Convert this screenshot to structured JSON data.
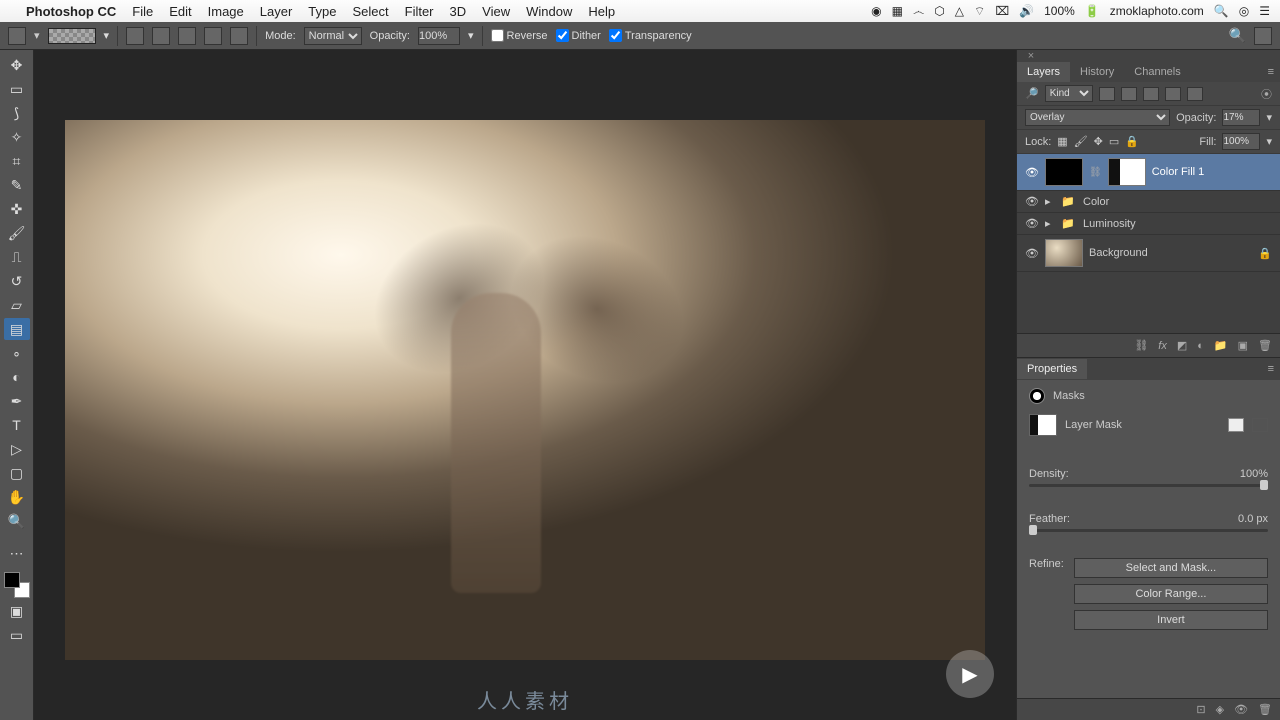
{
  "menubar": {
    "app": "Photoshop CC",
    "items": [
      "File",
      "Edit",
      "Image",
      "Layer",
      "Type",
      "Select",
      "Filter",
      "3D",
      "View",
      "Window",
      "Help"
    ],
    "battery": "100%",
    "site": "zmoklaphoto.com"
  },
  "options": {
    "mode_label": "Mode:",
    "mode_value": "Normal",
    "opacity_label": "Opacity:",
    "opacity_value": "100%",
    "reverse": "Reverse",
    "dither": "Dither",
    "transparency": "Transparency"
  },
  "tools": [
    "move",
    "marquee",
    "lasso",
    "wand",
    "crop",
    "eyedropper",
    "brush-heal",
    "brush",
    "stamp",
    "history-brush",
    "eraser",
    "gradient",
    "blur",
    "dodge",
    "pen",
    "type",
    "path-select",
    "rectangle",
    "hand",
    "zoom"
  ],
  "layers_panel": {
    "tabs": [
      "Layers",
      "History",
      "Channels"
    ],
    "active_tab": 0,
    "kind_label": "Kind",
    "blend_mode": "Overlay",
    "opacity_label": "Opacity:",
    "opacity_value": "17%",
    "lock_label": "Lock:",
    "fill_label": "Fill:",
    "fill_value": "100%",
    "layers": [
      {
        "name": "Color Fill 1",
        "type": "fill",
        "selected": true
      },
      {
        "name": "Color",
        "type": "group"
      },
      {
        "name": "Luminosity",
        "type": "group"
      },
      {
        "name": "Background",
        "type": "image",
        "locked": true
      }
    ]
  },
  "properties_panel": {
    "title": "Properties",
    "section": "Masks",
    "mask_type": "Layer Mask",
    "density_label": "Density:",
    "density_value": "100%",
    "feather_label": "Feather:",
    "feather_value": "0.0 px",
    "refine_label": "Refine:",
    "btn_select_mask": "Select and Mask...",
    "btn_color_range": "Color Range...",
    "btn_invert": "Invert"
  },
  "watermark": "人人素材"
}
